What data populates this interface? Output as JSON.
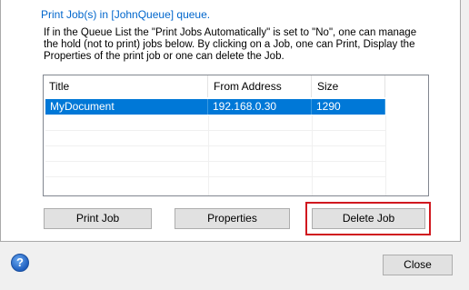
{
  "queue_title": "Print Job(s) in [JohnQueue] queue.",
  "description": "If in the Queue List the \"Print Jobs Automatically\" is set to \"No\", one can manage the hold (not to print) jobs below. By clicking on a Job, one can Print, Display the Properties of the print job or one can delete the Job.",
  "table": {
    "columns": [
      "Title",
      "From Address",
      "Size"
    ],
    "rows": [
      {
        "title": "MyDocument",
        "from_address": "192.168.0.30",
        "size": "1290",
        "selected": true
      }
    ]
  },
  "buttons": {
    "print_job": "Print Job",
    "properties": "Properties",
    "delete_job": "Delete Job",
    "close": "Close"
  },
  "help_icon_glyph": "?",
  "colors": {
    "selection": "#0078d7",
    "link_text": "#0066cc",
    "highlight_box": "#d0181f"
  }
}
